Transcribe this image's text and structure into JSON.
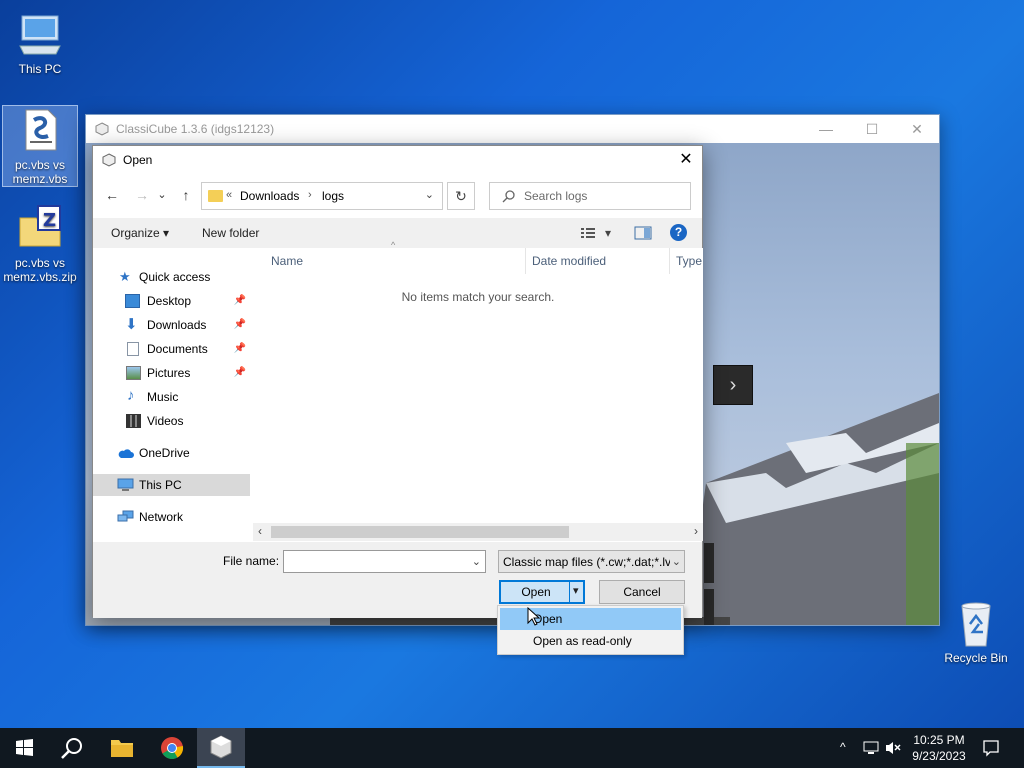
{
  "desktop": {
    "icons": [
      {
        "label": "This PC",
        "icon": "computer-icon"
      },
      {
        "label": "pc.vbs vs memz.vbs",
        "icon": "vbs-script-icon"
      },
      {
        "label": "pc.vbs vs memz.vbs.zip",
        "icon": "zip-folder-icon"
      },
      {
        "label": "Recycle Bin",
        "icon": "recycle-bin-icon"
      }
    ]
  },
  "app_window": {
    "title": "ClassiCube 1.3.6 (idgs12123)",
    "controls": {
      "minimize": "—",
      "maximize": "☐",
      "close": "✕"
    },
    "game_arrow": "›"
  },
  "dialog": {
    "title": "Open",
    "close": "✕",
    "nav": {
      "back": "←",
      "forward": "→",
      "recent": "⌄",
      "up": "↑"
    },
    "address": {
      "prefix": "«",
      "crumbs": [
        "Downloads",
        "logs"
      ],
      "sep": "›",
      "dropdown": "⌄"
    },
    "refresh": "↻",
    "search_placeholder": "Search logs",
    "toolbar": {
      "organize": "Organize ▾",
      "new_folder": "New folder",
      "view_dd": "▾",
      "help": "?"
    },
    "nav_pane": {
      "items": [
        {
          "label": "Quick access",
          "icon": "star-icon",
          "pinned": false
        },
        {
          "label": "Desktop",
          "icon": "desktop-icon",
          "pinned": true
        },
        {
          "label": "Downloads",
          "icon": "download-icon",
          "pinned": true
        },
        {
          "label": "Documents",
          "icon": "document-icon",
          "pinned": true
        },
        {
          "label": "Pictures",
          "icon": "picture-icon",
          "pinned": true
        },
        {
          "label": "Music",
          "icon": "music-icon",
          "pinned": false
        },
        {
          "label": "Videos",
          "icon": "video-icon",
          "pinned": false
        },
        {
          "label": "OneDrive",
          "icon": "cloud-icon",
          "pinned": false
        },
        {
          "label": "This PC",
          "icon": "computer-icon",
          "pinned": false,
          "selected": true
        },
        {
          "label": "Network",
          "icon": "network-icon",
          "pinned": false
        }
      ],
      "pin_glyph": "📌"
    },
    "columns": [
      "Name",
      "Date modified",
      "Type"
    ],
    "sort_glyph": "^",
    "empty_message": "No items match your search.",
    "scroll": {
      "left": "‹",
      "right": "›"
    },
    "file_name_label": "File name:",
    "file_name_value": "",
    "filter_value": "Classic map files (*.cw;*.dat;*.lvl",
    "filter_dd": "⌄",
    "open_button": "Open",
    "open_dd": "▾",
    "cancel_button": "Cancel",
    "open_menu": {
      "items": [
        "Open",
        "Open as read-only"
      ],
      "hovered": 0
    }
  },
  "taskbar": {
    "apps": [
      "start-icon",
      "search-icon",
      "file-explorer-icon",
      "chrome-icon",
      "classicube-icon"
    ],
    "tray": {
      "chevron": "^"
    },
    "clock": {
      "time": "10:25 PM",
      "date": "9/23/2023"
    }
  },
  "colors": {
    "accent": "#0078d7",
    "desktop": "#1466c8",
    "taskbar": "#101820"
  }
}
